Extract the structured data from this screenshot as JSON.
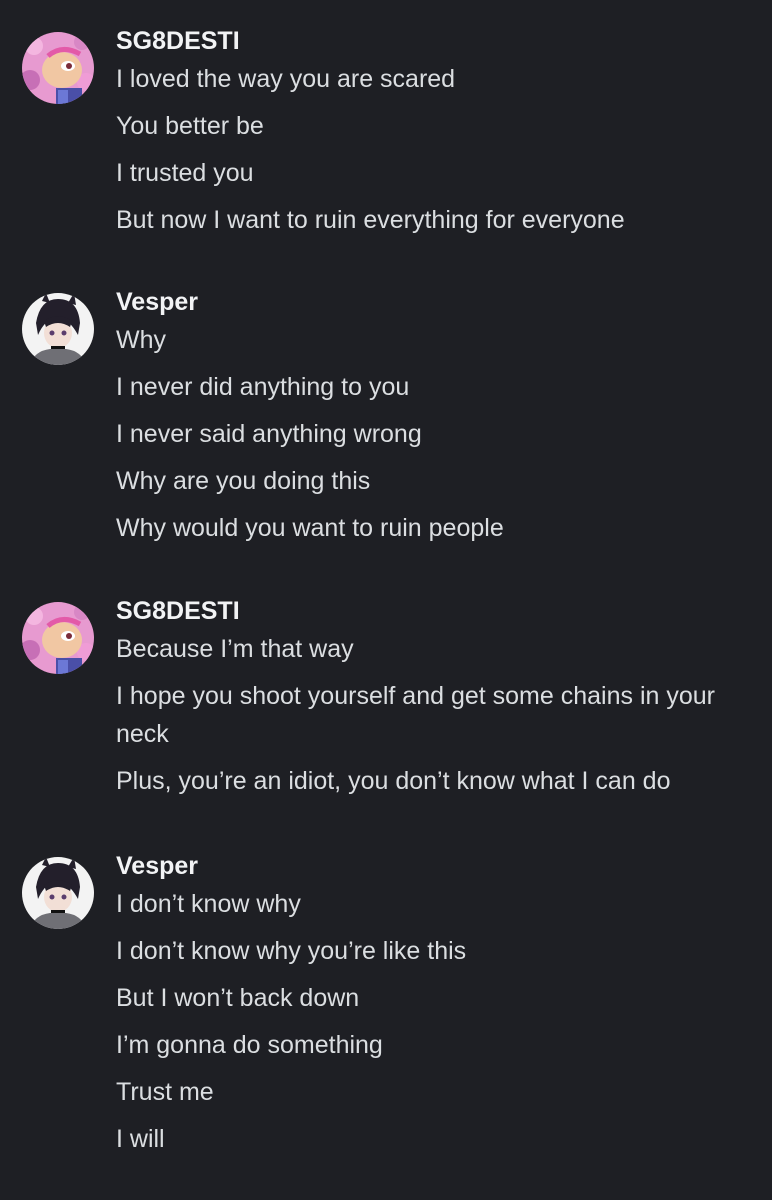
{
  "messages": [
    {
      "author": "SG8DESTI",
      "avatar_icon": "pink-anime-avatar-icon",
      "lines": [
        "I loved the way you are scared",
        "You better be",
        "I trusted you",
        "But now I want to ruin everything for everyone"
      ]
    },
    {
      "author": "Vesper",
      "avatar_icon": "dark-haired-anime-avatar-icon",
      "lines": [
        "Why",
        "I never did anything to you",
        "I never said anything wrong",
        "Why are you doing this",
        "Why would you want to ruin people"
      ]
    },
    {
      "author": "SG8DESTI",
      "avatar_icon": "pink-anime-avatar-icon",
      "lines": [
        "Because I’m that way",
        "I hope you shoot yourself and get some chains in your neck",
        "Plus, you’re an idiot, you don’t know what I can do"
      ]
    },
    {
      "author": "Vesper",
      "avatar_icon": "dark-haired-anime-avatar-icon",
      "lines": [
        "I don’t know why",
        "I don’t know why you’re like this",
        "But I won’t back down",
        "I’m gonna do something",
        "Trust me",
        "I will"
      ]
    }
  ],
  "colors": {
    "background": "#1e1f24",
    "author_text": "#f2f3f5",
    "message_text": "#dbdee1"
  }
}
